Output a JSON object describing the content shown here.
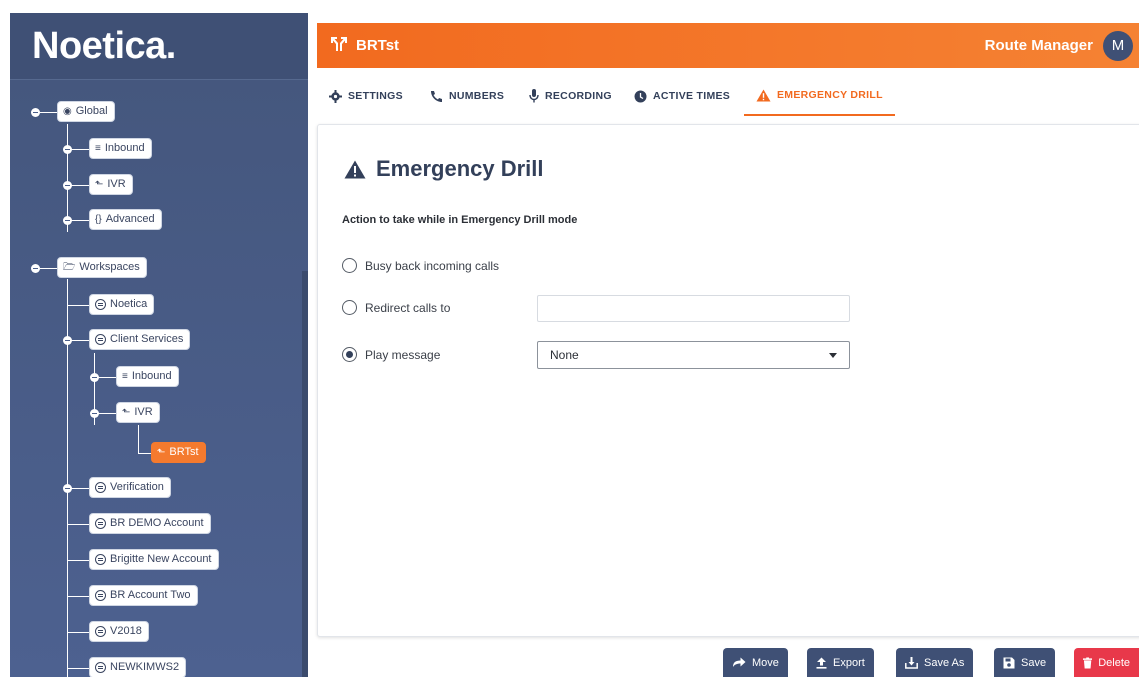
{
  "brand": {
    "name": "Noetica."
  },
  "header": {
    "title": "BRTst",
    "app_name": "Route Manager",
    "avatar_initial": "M",
    "bg_color": "#f26a1f"
  },
  "tabs": [
    {
      "label": "SETTINGS",
      "icon": "gear-icon"
    },
    {
      "label": "NUMBERS",
      "icon": "phone-icon"
    },
    {
      "label": "RECORDING",
      "icon": "microphone-icon"
    },
    {
      "label": "ACTIVE TIMES",
      "icon": "clock-icon"
    },
    {
      "label": "EMERGENCY DRILL",
      "icon": "warning-icon",
      "active": true
    }
  ],
  "tree": {
    "global": {
      "label": "Global",
      "children": [
        "Inbound",
        "IVR",
        "Advanced"
      ]
    },
    "workspaces": {
      "label": "Workspaces",
      "items": [
        "Noetica",
        "Client Services",
        "Inbound",
        "IVR",
        "BRTst",
        "Verification",
        "BR DEMO Account",
        "Brigitte New Account",
        "BR Account Two",
        "V2018",
        "NEWKIMWS2"
      ]
    }
  },
  "page": {
    "title": "Emergency Drill",
    "section_label": "Action to take while in Emergency Drill mode",
    "options": [
      {
        "label": "Busy back incoming calls",
        "checked": false
      },
      {
        "label": "Redirect calls to",
        "checked": false
      },
      {
        "label": "Play message",
        "checked": true
      }
    ],
    "redirect_value": "",
    "message_select": "None"
  },
  "actions": {
    "move": "Move",
    "export": "Export",
    "save_as": "Save As",
    "save": "Save",
    "delete": "Delete"
  },
  "colors": {
    "accent": "#f26a1f",
    "navy": "#3f5075",
    "danger": "#e8384a"
  }
}
